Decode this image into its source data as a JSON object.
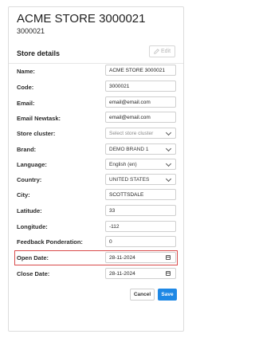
{
  "header": {
    "title": "ACME STORE 3000021",
    "subtitle": "3000021"
  },
  "section": {
    "title": "Store details",
    "edit_label": "Edit",
    "edit_icon": "pencil-icon"
  },
  "fields": {
    "name": {
      "label": "Name:",
      "value": "ACME STORE 3000021"
    },
    "code": {
      "label": "Code:",
      "value": "3000021"
    },
    "email": {
      "label": "Email:",
      "value": "email@email.com"
    },
    "email_newtask": {
      "label": "Email Newtask:",
      "value": "email@email.com"
    },
    "store_cluster": {
      "label": "Store cluster:",
      "placeholder": "Select store cluster"
    },
    "brand": {
      "label": "Brand:",
      "value": "DEMO BRAND 1"
    },
    "language": {
      "label": "Language:",
      "value": "English (en)"
    },
    "country": {
      "label": "Country:",
      "value": "UNITED STATES"
    },
    "city": {
      "label": "City:",
      "value": "SCOTTSDALE"
    },
    "latitude": {
      "label": "Latitude:",
      "value": "33"
    },
    "longitude": {
      "label": "Longitude:",
      "value": "-112"
    },
    "feedback_ponderation": {
      "label": "Feedback Ponderation:",
      "value": "0"
    },
    "open_date": {
      "label": "Open Date:",
      "value": "28-11-2024"
    },
    "close_date": {
      "label": "Close Date:",
      "value": "28-11-2024"
    }
  },
  "actions": {
    "cancel_label": "Cancel",
    "save_label": "Save"
  },
  "colors": {
    "accent": "#1e88e5",
    "highlight": "#d94b4b"
  }
}
